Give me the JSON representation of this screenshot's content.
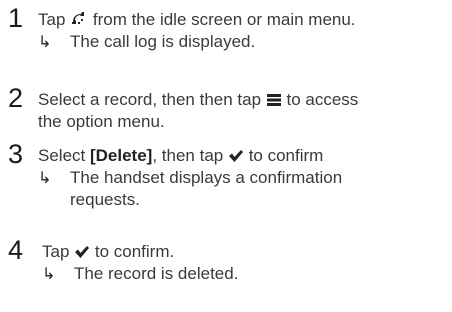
{
  "steps": [
    {
      "number": "1",
      "line1_pre": "Tap ",
      "line1_icon": "phone-icon",
      "line1_post": " from the idle screen or main menu.",
      "result": "The call log is displayed."
    },
    {
      "number": "2",
      "line1_pre": "Select a record, then then tap ",
      "line1_icon": "menu-icon",
      "line1_post": " to access",
      "line2": "the option menu."
    },
    {
      "number": "3",
      "line1_pre": "Select ",
      "line1_bold": "[Delete]",
      "line1_mid": ", then tap ",
      "line1_icon": "checkmark-icon",
      "line1_post": " to confirm",
      "result_line1": "The handset displays a confirmation",
      "result_line2": "requests."
    },
    {
      "number": "4",
      "line1_pre": "Tap ",
      "line1_icon": "checkmark-icon",
      "line1_post": " to confirm.",
      "result": "The record is deleted."
    }
  ],
  "result_arrow": "↳"
}
